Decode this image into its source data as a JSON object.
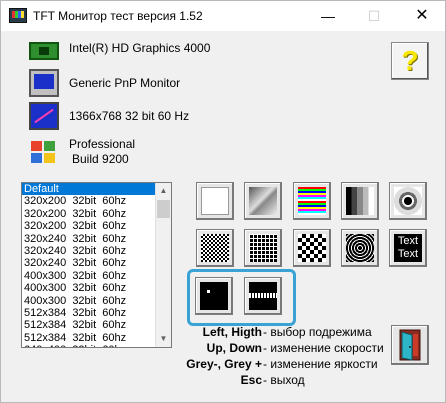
{
  "window": {
    "title": "TFT Монитор тест версия 1.52",
    "minimize": "—",
    "maximize": "☐",
    "close": "✕"
  },
  "info": {
    "graphics": "Intel(R) HD Graphics 4000",
    "monitor": "Generic PnP Monitor",
    "resolution": "1366x768 32 bit 60 Hz",
    "os_line1": "Professional",
    "os_line2": "Build 9200"
  },
  "help_label": "?",
  "modes": [
    "Default",
    "320x200  32bit  60hz",
    "320x200  32bit  60hz",
    "320x200  32bit  60hz",
    "320x240  32bit  60hz",
    "320x240  32bit  60hz",
    "320x240  32bit  60hz",
    "400x300  32bit  60hz",
    "400x300  32bit  60hz",
    "400x300  32bit  60hz",
    "512x384  32bit  60hz",
    "512x384  32bit  60hz",
    "512x384  32bit  60hz",
    "640x400  32bit  60hz"
  ],
  "scroll": {
    "up": "▲",
    "down": "▼"
  },
  "tests": [
    {
      "name": "white-screen"
    },
    {
      "name": "gradient"
    },
    {
      "name": "color-bars"
    },
    {
      "name": "gray-bars"
    },
    {
      "name": "circle"
    },
    {
      "name": "checkerboard-fine"
    },
    {
      "name": "grid"
    },
    {
      "name": "checkerboard-large"
    },
    {
      "name": "concentric-circles"
    },
    {
      "name": "dot-pattern"
    },
    {
      "name": "text",
      "line1": "Text",
      "line2": "Text"
    },
    {
      "name": "moving-dot"
    },
    {
      "name": "moving-bar"
    }
  ],
  "keys": [
    {
      "key": "Left, Higth",
      "desc": "- выбор подрежима"
    },
    {
      "key": "Up, Down",
      "desc": "- изменение скорости"
    },
    {
      "key": "Grey-, Grey +",
      "desc": "- изменение яркости"
    },
    {
      "key": "Esc",
      "desc": "- выход"
    }
  ],
  "colors": {
    "selection": "#0078d7",
    "highlight": "#3aa3d6",
    "help_question": "#f6e600"
  }
}
